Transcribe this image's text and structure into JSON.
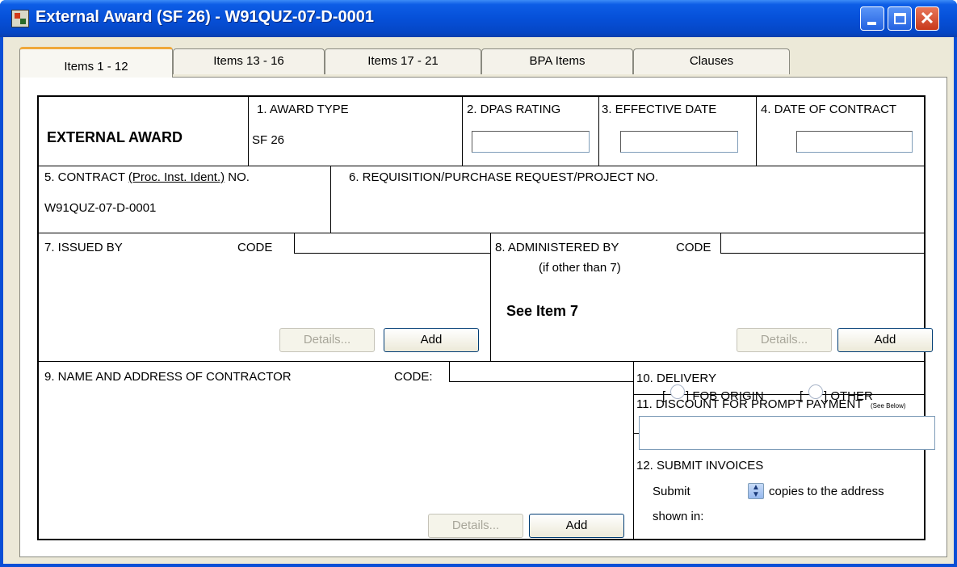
{
  "window": {
    "title": "External Award (SF 26) - W91QUZ-07-D-0001",
    "close_glyph": "✕"
  },
  "tabs": [
    {
      "label": "Items 1 - 12"
    },
    {
      "label": "Items 13 - 16"
    },
    {
      "label": "Items 17 - 21"
    },
    {
      "label": "BPA Items"
    },
    {
      "label": "Clauses"
    }
  ],
  "form": {
    "header_title": "EXTERNAL AWARD",
    "award_type_label": "1. AWARD TYPE",
    "award_type_value": "SF 26",
    "dpas_label": "2.  DPAS RATING",
    "dpas_value": "",
    "effective_date_label": "3. EFFECTIVE DATE",
    "effective_date_value": "",
    "date_of_contract_label": "4. DATE OF CONTRACT",
    "date_of_contract_value": "",
    "contract_label_prefix": "5. CONTRACT ",
    "contract_label_link": "(Proc. Inst. Ident.)",
    "contract_label_suffix": " NO.",
    "contract_value": "W91QUZ-07-D-0001",
    "requisition_label": "6. REQUISITION/PURCHASE  REQUEST/PROJECT NO.",
    "issued_by_label": "7.  ISSUED BY",
    "issued_by_code_label": "CODE",
    "issued_by_code_value": "",
    "administered_label": "8. ADMINISTERED BY",
    "administered_code_label": "CODE",
    "administered_code_value": "",
    "administered_note": "(if other than 7)",
    "see_item_7": "See Item 7",
    "contractor_label": "9. NAME AND ADDRESS OF CONTRACTOR",
    "contractor_code_label": "CODE:",
    "contractor_code_value": "",
    "delivery_label": "10. DELIVERY",
    "fob_origin_label": "] FOB ORIGIN",
    "other_label": "] OTHER",
    "see_below": "(See Below)",
    "bracket_open": "[",
    "discount_label": "11. DISCOUNT FOR PROMPT PAYMENT",
    "discount_value": "",
    "submit_invoices_label": "12. SUBMIT INVOICES",
    "submit_word": "Submit",
    "copies_text": "copies to the address",
    "shown_in_text": "shown in:",
    "details_button": "Details...",
    "add_button": "Add"
  }
}
